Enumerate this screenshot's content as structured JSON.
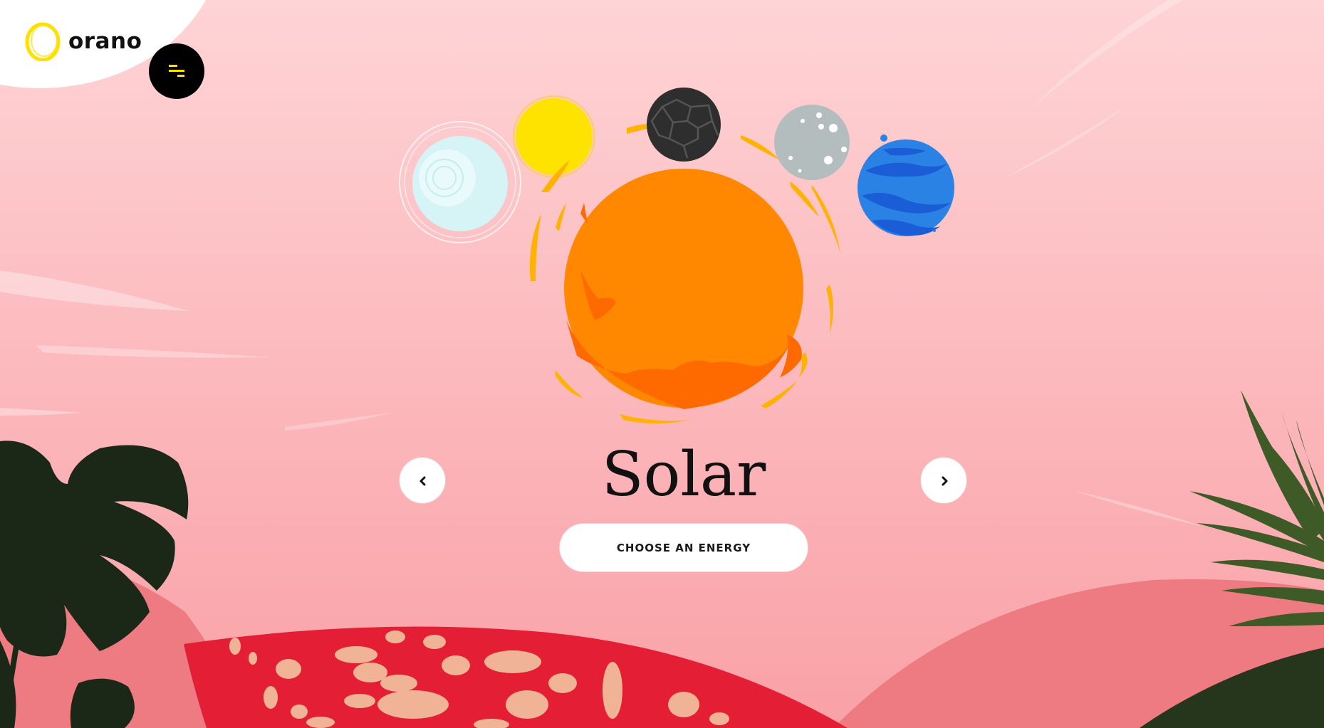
{
  "brand": {
    "name": "orano",
    "logo_color": "#ffe000"
  },
  "menu": {
    "icon": "menu-lines-icon",
    "icon_color": "#ffe000"
  },
  "carousel": {
    "current_energy": "Solar",
    "planets": [
      {
        "name": "ice-planet-icon",
        "color": "#d6f3f6"
      },
      {
        "name": "yellow-planet-icon",
        "color": "#ffe300"
      },
      {
        "name": "coal-planet-icon",
        "color": "#2e2e2e"
      },
      {
        "name": "sun-planet-icon",
        "color": "#ff8800"
      },
      {
        "name": "grey-moon-planet-icon",
        "color": "#b3bdbe"
      },
      {
        "name": "blue-water-planet-icon",
        "color": "#2a82e4"
      }
    ],
    "prev_icon": "chevron-left-icon",
    "next_icon": "chevron-right-icon"
  },
  "cta": {
    "label": "CHOOSE AN ENERGY"
  },
  "theme": {
    "background_top": "#fed4d6",
    "background_bottom": "#f9a1a6",
    "hill_red": "#e41e35",
    "hill_pink": "#ee7a82",
    "leaf_dark": "#1b2818",
    "leaf_green": "#3e5a26",
    "spot_color": "#f0b396"
  }
}
